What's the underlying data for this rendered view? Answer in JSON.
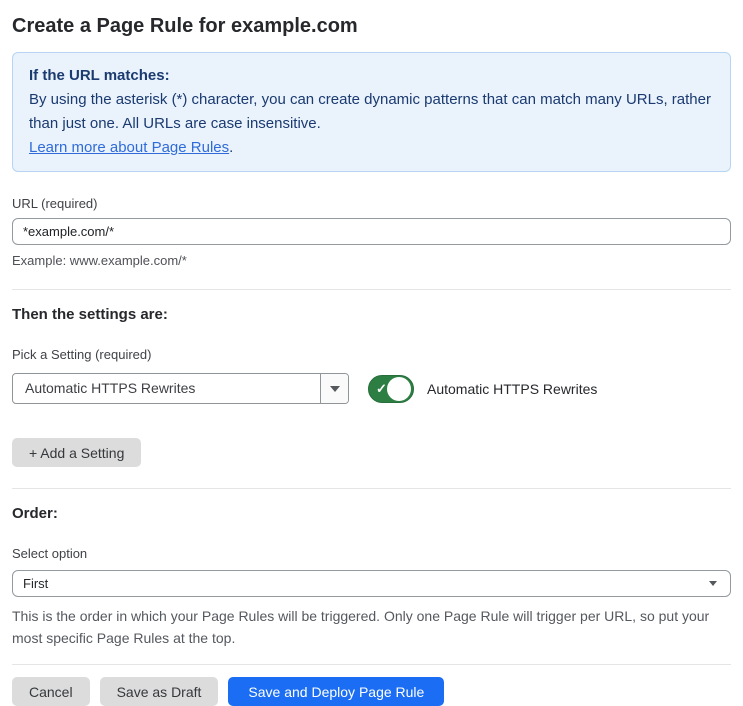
{
  "page": {
    "title": "Create a Page Rule for example.com"
  },
  "info_box": {
    "heading": "If the URL matches:",
    "body": "By using the asterisk (*) character, you can create dynamic patterns that can match many URLs, rather than just one. All URLs are case insensitive.",
    "link_label": "Learn more about Page Rules",
    "link_suffix": "."
  },
  "url_field": {
    "label": "URL (required)",
    "value": "*example.com/*",
    "helper": "Example: www.example.com/*"
  },
  "settings_section": {
    "heading": "Then the settings are:",
    "picker_label": "Pick a Setting (required)",
    "picker_value": "Automatic HTTPS Rewrites",
    "toggle_state": "on",
    "toggle_check": "✓",
    "toggle_label": "Automatic HTTPS Rewrites",
    "add_setting_label": "+ Add a Setting"
  },
  "order_section": {
    "heading": "Order:",
    "select_label": "Select option",
    "select_value": "First",
    "helper": "This is the order in which your Page Rules will be triggered. Only one Page Rule will trigger per URL, so put your most specific Page Rules at the top."
  },
  "actions": {
    "cancel": "Cancel",
    "save_draft": "Save as Draft",
    "save_deploy": "Save and Deploy Page Rule"
  },
  "colors": {
    "accent_blue": "#1b6ef3",
    "info_bg": "#eaf3fc",
    "info_border": "#b7d5f3",
    "info_text": "#1a3a70",
    "link_blue": "#2f6bd9",
    "toggle_green": "#2d7e43"
  }
}
